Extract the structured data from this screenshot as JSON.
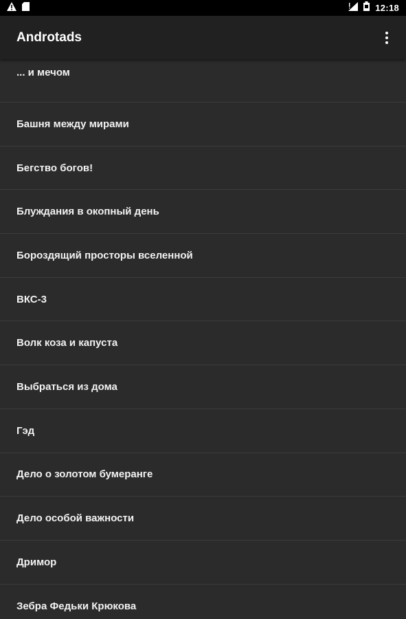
{
  "status_bar": {
    "time": "12:18",
    "left_icons": [
      "warning-icon",
      "sd-card-icon"
    ],
    "right_icons": [
      "signal-icon",
      "battery-icon"
    ]
  },
  "app_bar": {
    "title": "Androtads",
    "menu_icon": "more-vert-icon"
  },
  "list": {
    "items": [
      {
        "label": "... и мечом"
      },
      {
        "label": "Башня между мирами"
      },
      {
        "label": "Бегство богов!"
      },
      {
        "label": "Блуждания в окопный день"
      },
      {
        "label": "Бороздящий просторы вселенной"
      },
      {
        "label": "ВКС-3"
      },
      {
        "label": "Волк коза и капуста"
      },
      {
        "label": "Выбраться из дома"
      },
      {
        "label": "Гэд"
      },
      {
        "label": "Дело о золотом бумеранге"
      },
      {
        "label": "Дело особой важности"
      },
      {
        "label": "Дримор"
      },
      {
        "label": "Зебра Федьки Крюкова"
      }
    ]
  },
  "colors": {
    "status_bar_bg": "#000000",
    "app_bar_bg": "#212121",
    "list_bg": "#2b2b2b",
    "divider": "#3c3c3c",
    "text": "#f2f2f2"
  }
}
